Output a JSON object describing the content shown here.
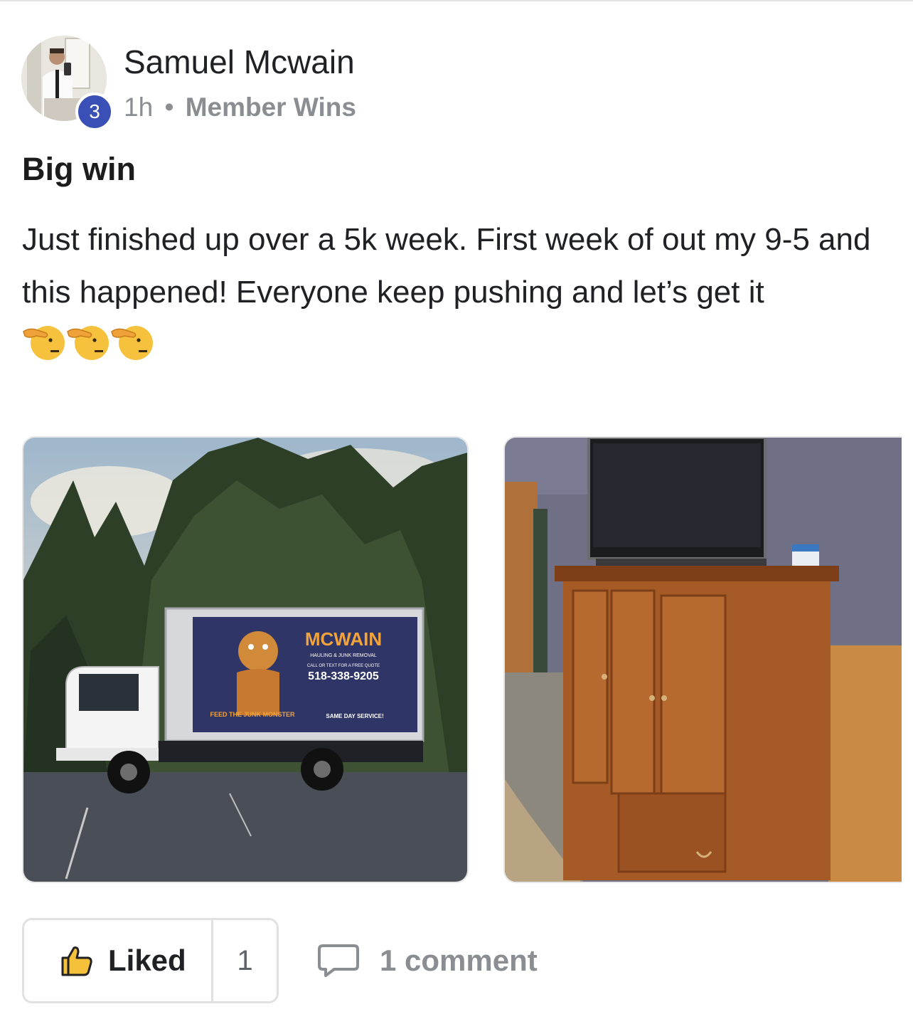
{
  "post": {
    "author": "Samuel Mcwain",
    "level": "3",
    "time": "1h",
    "separator": "•",
    "category": "Member Wins",
    "title": "Big win",
    "body": "Just finished up over a 5k week. First week of out my 9-5 and this happened! Everyone keep pushing and let’s get it",
    "emojis": [
      "pointing-left-face-emoji",
      "pointing-left-face-emoji",
      "pointing-left-face-emoji"
    ]
  },
  "photos": {
    "truck": {
      "brand": "MCWAIN",
      "tagline": "HAULING & JUNK REMOVAL",
      "call_text": "CALL OR TEXT FOR A FREE QUOTE",
      "phone": "518-338-9205",
      "slogan": "FEED THE JUNK MONSTER",
      "service": "SAME DAY SERVICE!"
    }
  },
  "actions": {
    "like_label": "Liked",
    "like_count": "1",
    "comment_label": "1 comment"
  },
  "colors": {
    "badge": "#3b50b6",
    "meta_text": "#8a8d91",
    "border": "#e1e1e1"
  }
}
